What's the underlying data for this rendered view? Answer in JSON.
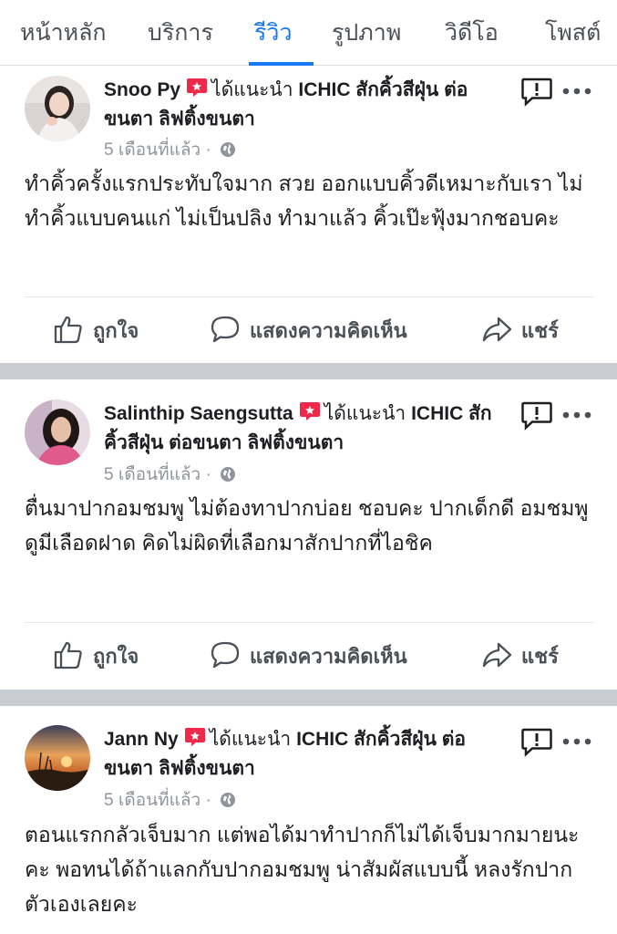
{
  "tabs": [
    {
      "label": "หน้าหลัก",
      "active": false
    },
    {
      "label": "บริการ",
      "active": false
    },
    {
      "label": "รีวิว",
      "active": true
    },
    {
      "label": "รูปภาพ",
      "active": false
    },
    {
      "label": "วิดีโอ",
      "active": false
    },
    {
      "label": "โพสต์",
      "active": false
    }
  ],
  "posts": [
    {
      "author": "Snoo Py",
      "recommends": "ได้แนะนำ",
      "page": "ICHIC สักคิ้วสีฝุ่น ต่อขนตา ลิฟติ้งขนตา",
      "time": "5 เดือนที่แล้ว ·",
      "text": "ทำคิ้วครั้งแรกประทับใจมาก สวย ออกแบบคิ้วดีเหมาะกับเรา ไม่ทำคิ้วแบบคนแก่ ไม่เป็นปลิง ทำมาแล้ว คิ้วเป๊ะฟุ้งมากชอบคะ"
    },
    {
      "author": "Salinthip Saengsutta",
      "recommends": "ได้แนะนำ",
      "page": "ICHIC สักคิ้วสีฝุ่น ต่อขนตา ลิฟติ้งขนตา",
      "time": "5 เดือนที่แล้ว ·",
      "text": "ตื่นมาปากอมชมพู ไม่ต้องทาปากบ่อย ชอบคะ  ปากเด็กดี  อมชมพูดูมีเลือดฝาด คิดไม่ผิดที่เลือกมาสักปากที่ไอชิค"
    },
    {
      "author": "Jann Ny",
      "recommends": "ได้แนะนำ",
      "page": "ICHIC สักคิ้วสีฝุ่น ต่อขนตา ลิฟติ้งขนตา",
      "time": "5 เดือนที่แล้ว ·",
      "text": "ตอนแรกกลัวเจ็บมาก แต่พอได้มาทำปากก็ไม่ได้เจ็บมากมายนะคะ พอทนได้ถ้าแลกกับปากอมชมพู น่าสัมผัสแบบนี้ หลงรักปากตัวเองเลยคะ"
    }
  ],
  "actions": {
    "like": "ถูกใจ",
    "comment": "แสดงความคิดเห็น",
    "share": "แชร์"
  },
  "icons": {
    "recommend": "recommend-icon",
    "globe": "globe-icon",
    "report": "report-icon",
    "more": "more-icon",
    "like": "thumbs-up-icon",
    "comment": "comment-icon",
    "share": "share-icon"
  },
  "colors": {
    "accent": "#1877f2",
    "recommend": "#f02849",
    "separator": "#c9ccd1",
    "secondary_text": "#90949c"
  }
}
